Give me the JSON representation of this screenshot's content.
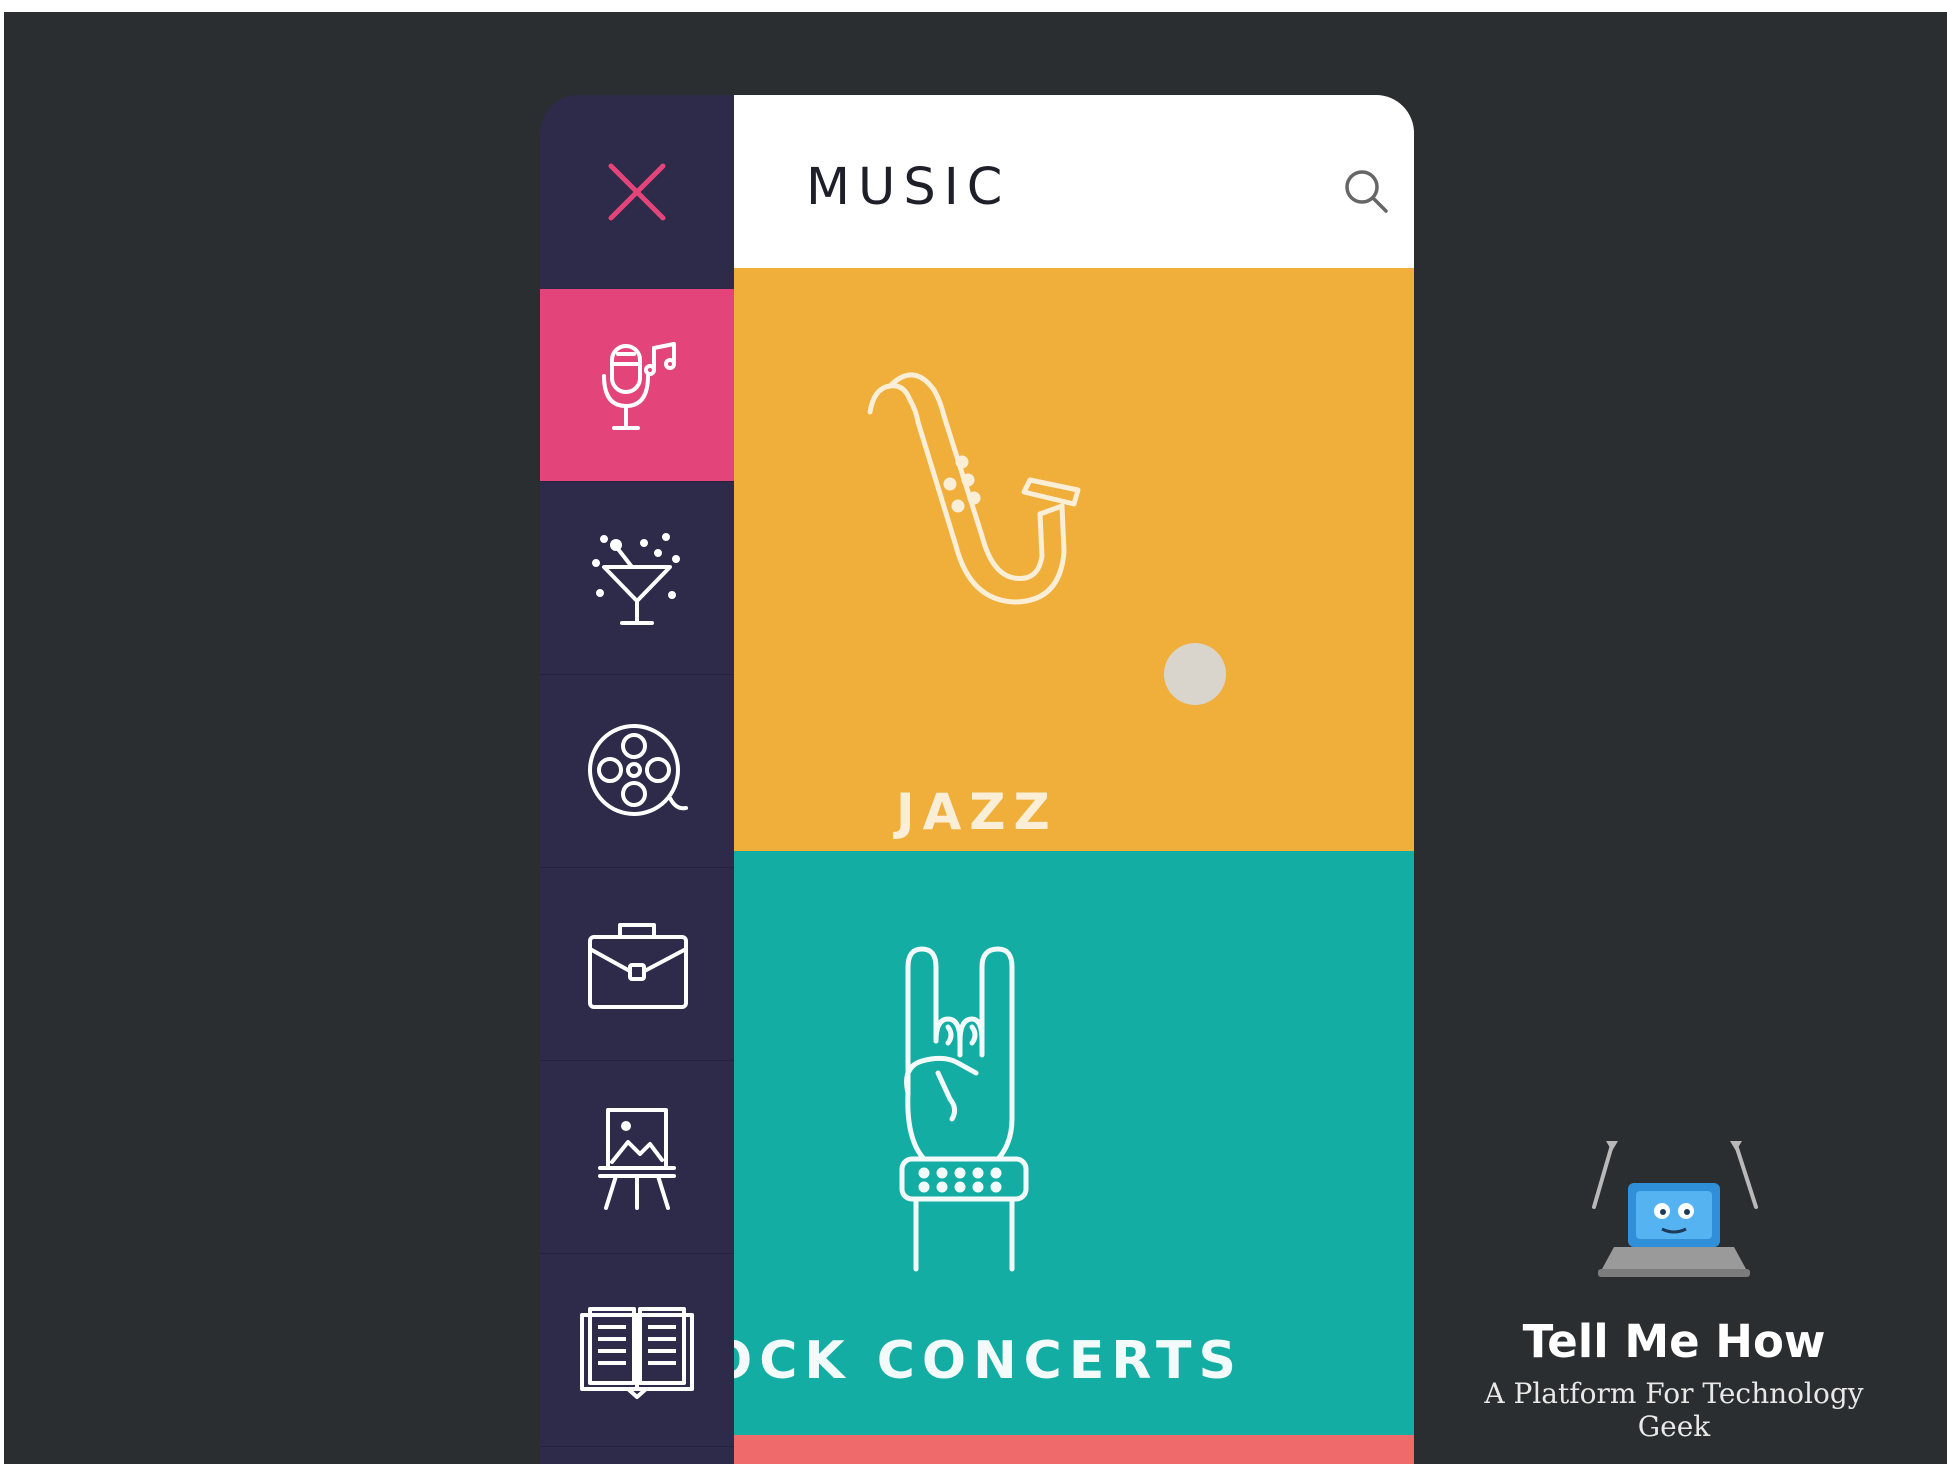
{
  "header": {
    "title": "MUSIC"
  },
  "sidebar": {
    "close_icon": "close-icon",
    "items": [
      {
        "id": "music",
        "icon": "microphone-icon",
        "active": true
      },
      {
        "id": "nightlife",
        "icon": "cocktail-icon",
        "active": false
      },
      {
        "id": "movies",
        "icon": "film-reel-icon",
        "active": false
      },
      {
        "id": "business",
        "icon": "briefcase-icon",
        "active": false
      },
      {
        "id": "art",
        "icon": "easel-painting-icon",
        "active": false
      },
      {
        "id": "books",
        "icon": "open-book-icon",
        "active": false
      }
    ]
  },
  "categories": [
    {
      "label": "JAZZ",
      "icon": "saxophone-icon",
      "color": "#f0ae3a"
    },
    {
      "label": "ROCK CONCERTS",
      "visible_label": "OCK CONCERTS",
      "icon": "rock-hand-icon",
      "color": "#14ada4"
    },
    {
      "label": "",
      "color": "#ef6a6a"
    }
  ],
  "watermark": {
    "title": "Tell Me How",
    "subtitle": "A Platform For Technology Geek"
  },
  "colors": {
    "background": "#2a2e31",
    "sidebar": "#2d2a4a",
    "active": "#e3457a",
    "close": "#e3457a"
  }
}
